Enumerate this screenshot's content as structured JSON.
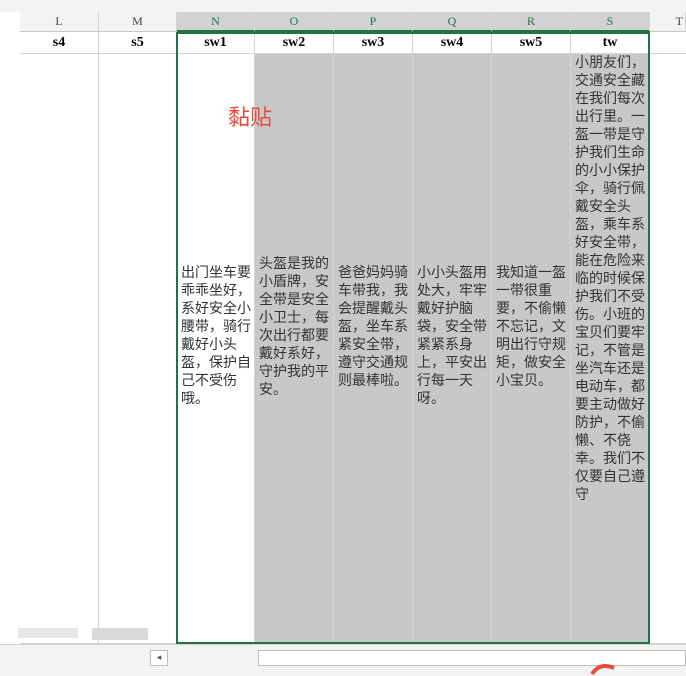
{
  "columns": [
    {
      "letter": "L",
      "header": "s4"
    },
    {
      "letter": "M",
      "header": "s5"
    },
    {
      "letter": "N",
      "header": "sw1"
    },
    {
      "letter": "O",
      "header": "sw2"
    },
    {
      "letter": "P",
      "header": "sw3"
    },
    {
      "letter": "Q",
      "header": "sw4"
    },
    {
      "letter": "R",
      "header": "sw5"
    },
    {
      "letter": "S",
      "header": "tw"
    },
    {
      "letter": "T",
      "header": ""
    }
  ],
  "cells": {
    "sw1": "出门坐车要乖乖坐好，系好安全小腰带，骑行戴好小头盔，保护自己不受伤哦。",
    "sw2": "头盔是我的小盾牌，安全带是安全小卫士，每次出行都要戴好系好，守护我的平安。",
    "sw3": "爸爸妈妈骑车带我，我会提醒戴头盔，坐车系紧安全带，遵守交通规则最棒啦。",
    "sw4": "小小头盔用处大，牢牢戴好护脑袋，安全带紧紧系身上，平安出行每一天呀。",
    "sw5": "我知道一盔一带很重要，不偷懒不忘记，文明出行守规矩，做安全小宝贝。",
    "tw": "小朋友们，交通安全藏在我们每次出行里。一盔一带是守护我们生命的小小保护伞，骑行佩戴安全头盔，乘车系好安全带，能在危险来临的时候保护我们不受伤。小班的宝贝们要牢记，不管是坐汽车还是电动车，都要主动做好防护，不偷懒、不侥幸。我们不仅要自己遵守"
  },
  "annotation": "黏贴",
  "scroll": {
    "left_arrow": "◂"
  },
  "colors": {
    "selection": "#217346",
    "paste_text": "#e84c3d",
    "gray_fill": "#c8c8c8"
  }
}
